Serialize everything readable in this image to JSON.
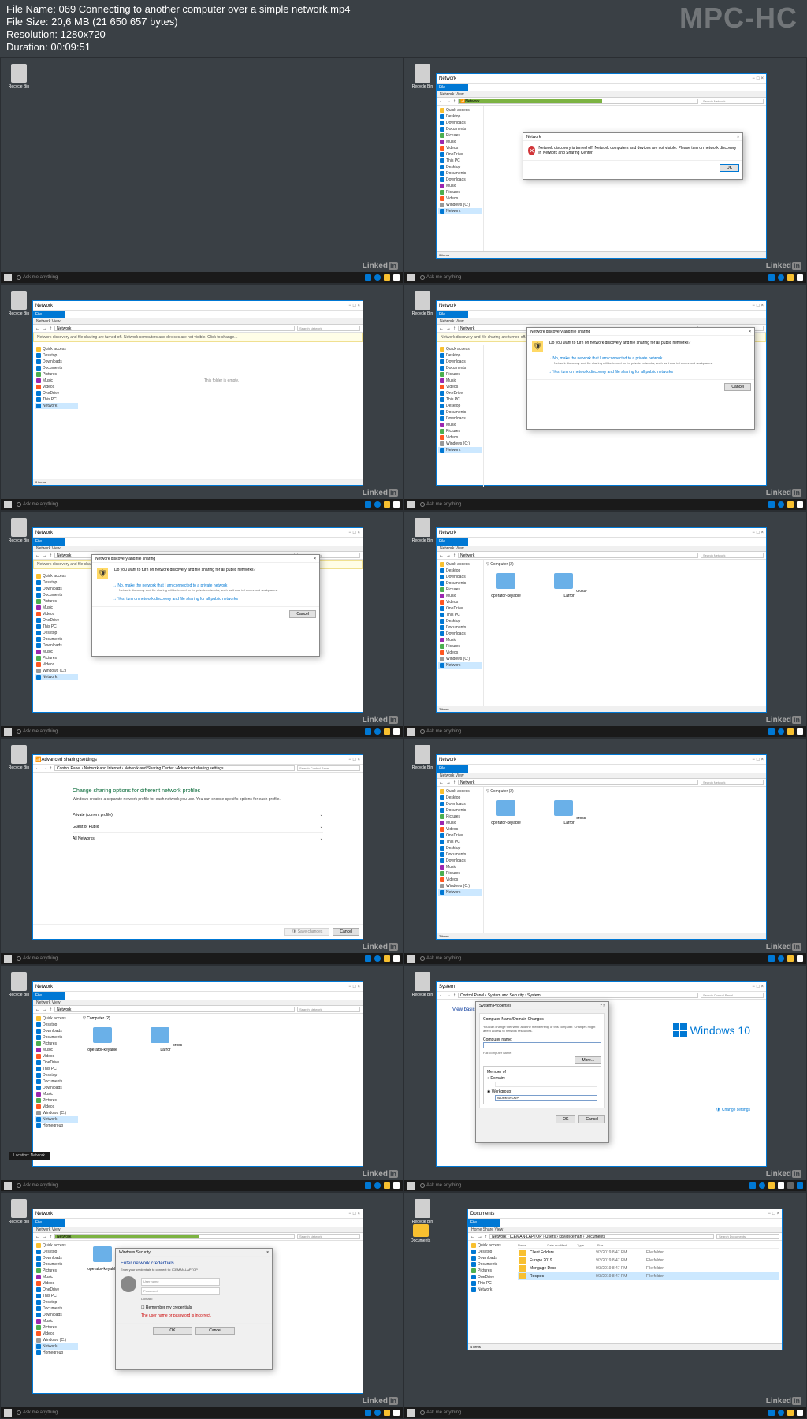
{
  "fileinfo": {
    "name_label": "File Name:",
    "name": "069 Connecting to another computer over a simple network.mp4",
    "size_label": "File Size:",
    "size": "20,6 MB (21 650 657 bytes)",
    "res_label": "Resolution:",
    "res": "1280x720",
    "dur_label": "Duration:",
    "dur": "00:09:51"
  },
  "logo": "MPC-HC",
  "common": {
    "recycle": "Recycle Bin",
    "linkedin": "Linked",
    "search_task": "Ask me anything",
    "search_net": "Search Network",
    "network": "Network",
    "this_pc": "This PC",
    "quick": "Quick access",
    "desktop": "Desktop",
    "downloads": "Downloads",
    "documents": "Documents",
    "pictures": "Pictures",
    "music": "Music",
    "videos": "Videos",
    "windows_c": "Windows (C:)",
    "one_drive": "OneDrive",
    "homegroup": "Homegroup",
    "ok": "OK",
    "cancel": "Cancel",
    "items": "0 items",
    "ribbon_net": "Network    View"
  },
  "t2": {
    "dlg_title": "Network",
    "dlg_msg": "Network discovery is turned off. Network computers and devices are not visible. Please turn on network discovery in Network and Sharing Center."
  },
  "t3": {
    "yellow": "Network discovery and file sharing are turned off. Network computers and devices are not visible. Click to change...",
    "empty": "This folder is empty."
  },
  "t4": {
    "title": "Network discovery and file sharing",
    "q": "Do you want to turn on network discovery and file sharing for all public networks?",
    "opt1": "No, make the network that I am connected to a private network",
    "opt1b": "Network discovery and file sharing will be turned on for private networks, such as those in homes and workplaces.",
    "opt2": "Yes, turn on network discovery and file sharing for all public networks"
  },
  "t6": {
    "heading": "Computer (2)",
    "c1": "operator-keyable",
    "c2": "cross-Larror"
  },
  "t7": {
    "title": "Advanced sharing settings",
    "bc": "Control Panel  ›  Network and Internet  ›  Network and Sharing Center  ›  Advanced sharing settings",
    "h": "Change sharing options for different network profiles",
    "sub": "Windows creates a separate network profile for each network you use. You can choose specific options for each profile.",
    "p1": "Private (current profile)",
    "p2": "Guest or Public",
    "p3": "All Networks",
    "save": "Save changes"
  },
  "t10": {
    "title": "System",
    "bc": "Control Panel  ›  System and Security  ›  System",
    "dlg_title": "System Properties",
    "dlg_sub": "Computer Name/Domain Changes",
    "dlg_msg": "You can change the name and the membership of this computer. Changes might affect access to network resources.",
    "cn_label": "Computer name:",
    "full_label": "Full computer name:",
    "member": "Member of",
    "domain": "Domain:",
    "workgroup": "Workgroup:",
    "wg_val": "WORKGROUP",
    "more": "More...",
    "win10": "Windows 10",
    "view_info": "View basic information about your computer",
    "change": "Change settings"
  },
  "t11": {
    "dlg_title": "Windows Security",
    "h": "Enter network credentials",
    "sub": "Enter your credentials to connect to: ICEMAN-LAPTOP",
    "user": "User name",
    "pass": "Password",
    "domain": "Domain:",
    "remember": "Remember my credentials",
    "err": "The user name or password is incorrect."
  },
  "t12": {
    "bc": "Network  ›  ICEMAN-LAPTOP  ›  Users  ›  kdv@iceman  ›  Documents",
    "cols": "Name                        Date modified            Type               Size",
    "f1": "Client Folders",
    "f2": "Europe 2019",
    "f3": "Mortgage Docs",
    "f4": "Recipes",
    "d": "9/3/2019 8:47 PM",
    "t": "File folder",
    "doc_label": "Documents"
  }
}
